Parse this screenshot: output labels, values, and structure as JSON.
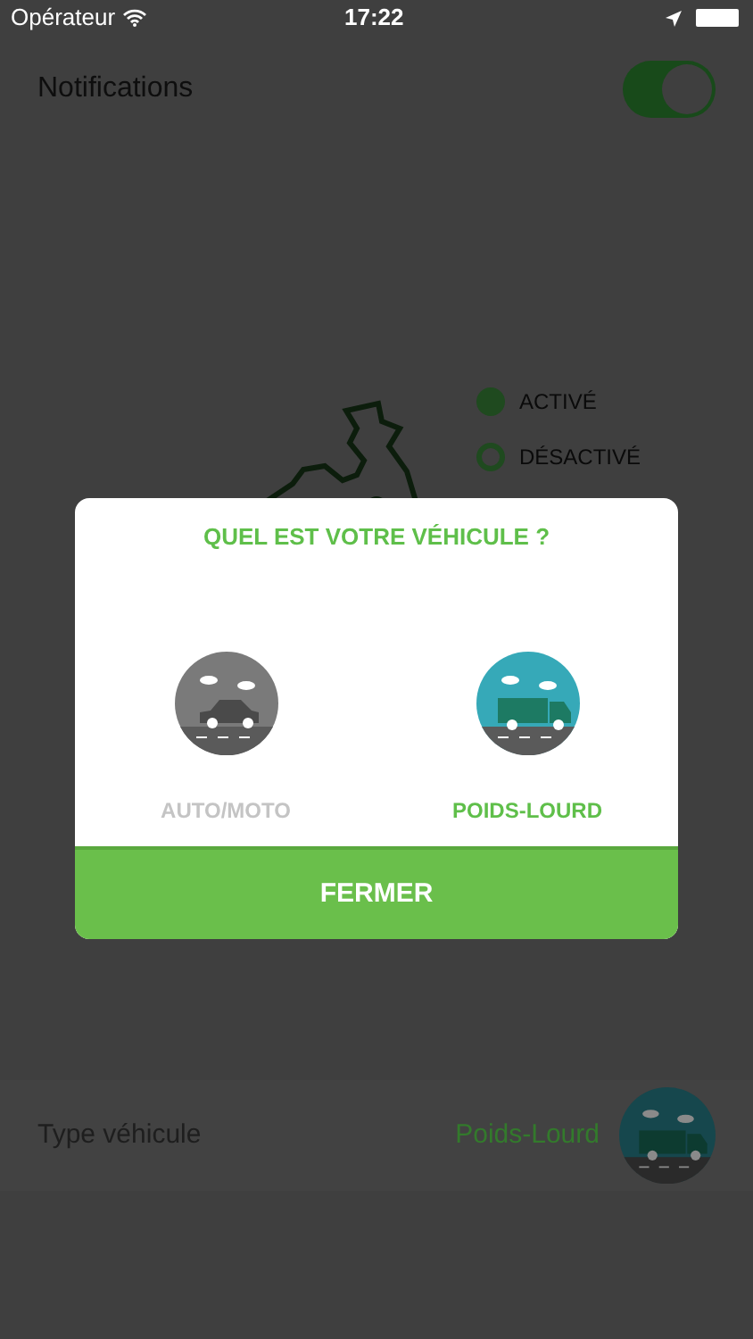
{
  "status_bar": {
    "carrier": "Opérateur",
    "time": "17:22"
  },
  "notifications": {
    "label": "Notifications",
    "on": true
  },
  "map_legend": [
    {
      "label": "ACTIVÉ",
      "kind": "filled"
    },
    {
      "label": "DÉSACTIVÉ",
      "kind": "outline"
    }
  ],
  "dialog": {
    "title": "QUEL EST VOTRE VÉHICULE ?",
    "options": [
      {
        "label": "AUTO/MOTO",
        "kind": "car",
        "selected": false
      },
      {
        "label": "POIDS-LOURD",
        "kind": "truck",
        "selected": true
      }
    ],
    "button": "FERMER"
  },
  "vehicle_type": {
    "label": "Type véhicule",
    "value": "Poids-Lourd"
  }
}
